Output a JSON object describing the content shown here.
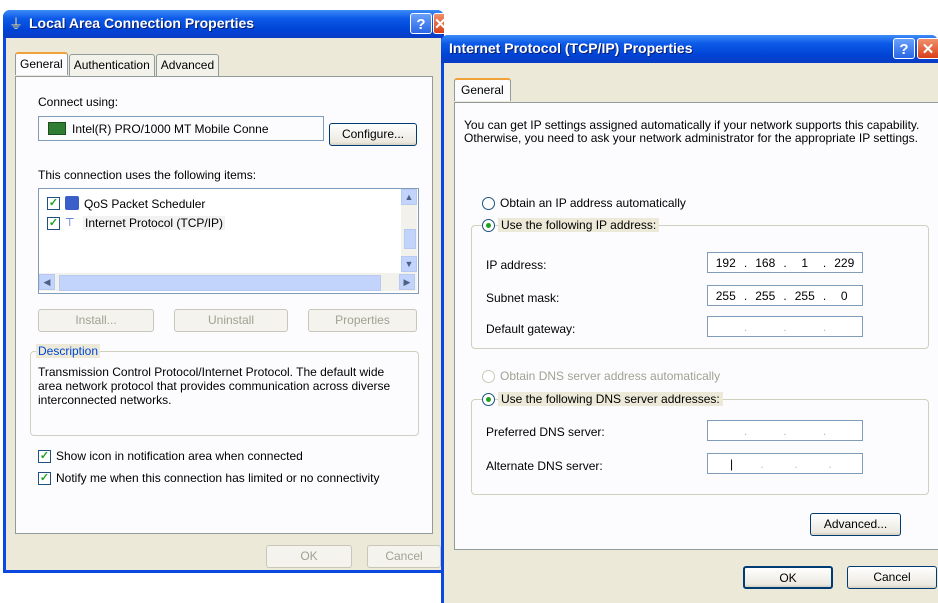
{
  "lan": {
    "title": "Local Area Connection Properties",
    "tabs": [
      "General",
      "Authentication",
      "Advanced"
    ],
    "connect_using_label": "Connect using:",
    "adapter_name": "Intel(R) PRO/1000 MT Mobile Conne",
    "configure_button": "Configure...",
    "items_label": "This connection uses the following items:",
    "items": [
      {
        "label": "QoS Packet Scheduler",
        "checked": true,
        "icon": "scheduler-icon"
      },
      {
        "label": "Internet Protocol (TCP/IP)",
        "checked": true,
        "icon": "protocol-icon"
      }
    ],
    "install_button": "Install...",
    "uninstall_button": "Uninstall",
    "properties_button": "Properties",
    "description_label": "Description",
    "description_text": "Transmission Control Protocol/Internet Protocol. The default wide area network protocol that provides communication across diverse interconnected networks.",
    "show_icon_label": "Show icon in notification area when connected",
    "notify_label": "Notify me when this connection has limited or no connectivity",
    "ok_button": "OK",
    "cancel_button": "Cancel"
  },
  "tcpip": {
    "title": "Internet Protocol (TCP/IP) Properties",
    "tabs": [
      "General"
    ],
    "intro_text": "You can get IP settings assigned automatically if your network supports this capability. Otherwise, you need to ask your network administrator for the appropriate IP settings.",
    "obtain_ip_auto_label": "Obtain an IP address automatically",
    "use_following_ip_label": "Use the following IP address:",
    "ip_address_label": "IP address:",
    "ip_address_octets": [
      "192",
      "168",
      "1",
      "229"
    ],
    "subnet_mask_label": "Subnet mask:",
    "subnet_mask_octets": [
      "255",
      "255",
      "255",
      "0"
    ],
    "default_gateway_label": "Default gateway:",
    "obtain_dns_auto_label": "Obtain DNS server address automatically",
    "use_following_dns_label": "Use the following DNS server addresses:",
    "preferred_dns_label": "Preferred DNS server:",
    "alternate_dns_label": "Alternate DNS server:",
    "advanced_button": "Advanced...",
    "ok_button": "OK",
    "cancel_button": "Cancel",
    "selected_ip_mode": "manual",
    "selected_dns_mode": "manual"
  },
  "colors": {
    "titlebar": "#0a48e0",
    "dialog_bg": "#ece9d8",
    "radio_dot": "#21a121"
  }
}
